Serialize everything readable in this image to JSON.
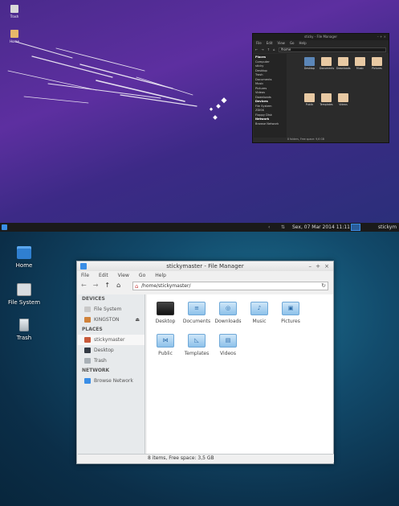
{
  "top_desktop": {
    "icons": [
      {
        "label": "Trash",
        "color": "#d9d9d9"
      },
      {
        "label": "Home",
        "color": "#e8b76a"
      }
    ],
    "dark_file_manager": {
      "title": "sticky - File Manager",
      "controls": "– + ×",
      "menu": [
        "File",
        "Edit",
        "View",
        "Go",
        "Help"
      ],
      "address": "/home",
      "sidebar": [
        "Places",
        "Computer",
        "sticky",
        "Desktop",
        "Trash",
        "Documents",
        "Music",
        "Pictures",
        "Videos",
        "Downloads",
        "Devices",
        "File System",
        "ZDISK",
        "Floppy Disk",
        "Network",
        "Browse Network"
      ],
      "items": [
        "Desktop",
        "Documents",
        "Downloads",
        "Music",
        "Pictures",
        "Public",
        "Templates",
        "Videos"
      ],
      "status": "8 folders, Free space: 9,6 GB"
    },
    "panel": {
      "tray_a": "‹",
      "tray_b": "⇅",
      "clock": "Sex, 07 Mar 2014 11:11",
      "user": "stickym"
    }
  },
  "desktop": {
    "icons": [
      {
        "label": "Home",
        "icon": "home-folder-icon"
      },
      {
        "label": "File System",
        "icon": "drive-icon"
      },
      {
        "label": "Trash",
        "icon": "trash-icon"
      }
    ]
  },
  "file_manager": {
    "title": "stickymaster - File Manager",
    "window_controls": {
      "minimize": "–",
      "maximize": "+",
      "close": "×"
    },
    "menu": [
      "File",
      "Edit",
      "View",
      "Go",
      "Help"
    ],
    "toolbar": {
      "back": "←",
      "forward": "→",
      "up": "↑",
      "home": "⌂"
    },
    "address": "/home/stickymaster/",
    "reload": "↻",
    "sidebar": {
      "devices_header": "DEVICES",
      "devices": [
        {
          "label": "File System",
          "icon": "drive-icon",
          "color": "#c8c8c8"
        },
        {
          "label": "KINGSTON",
          "icon": "usb-drive-icon",
          "color": "#d0823a",
          "eject": "⏏"
        }
      ],
      "places_header": "PLACES",
      "places": [
        {
          "label": "stickymaster",
          "icon": "home-icon",
          "color": "#c85a3a",
          "selected": true
        },
        {
          "label": "Desktop",
          "icon": "desktop-icon",
          "color": "#333a44"
        },
        {
          "label": "Trash",
          "icon": "trash-icon",
          "color": "#a8b0b6"
        }
      ],
      "network_header": "NETWORK",
      "network": [
        {
          "label": "Browse Network",
          "icon": "network-icon",
          "color": "#3a8ee6"
        }
      ]
    },
    "items": [
      {
        "label": "Desktop",
        "icon": "desktop-folder-icon",
        "mark": ""
      },
      {
        "label": "Documents",
        "icon": "documents-folder-icon",
        "mark": "≡"
      },
      {
        "label": "Downloads",
        "icon": "downloads-folder-icon",
        "mark": "◎"
      },
      {
        "label": "Music",
        "icon": "music-folder-icon",
        "mark": "♪"
      },
      {
        "label": "Pictures",
        "icon": "pictures-folder-icon",
        "mark": "▣"
      },
      {
        "label": "Public",
        "icon": "public-folder-icon",
        "mark": "⋈"
      },
      {
        "label": "Templates",
        "icon": "templates-folder-icon",
        "mark": "◺"
      },
      {
        "label": "Videos",
        "icon": "videos-folder-icon",
        "mark": "▤"
      }
    ],
    "status": "8 items, Free space: 3,5 GB",
    "accent": "#3a8ee6"
  }
}
